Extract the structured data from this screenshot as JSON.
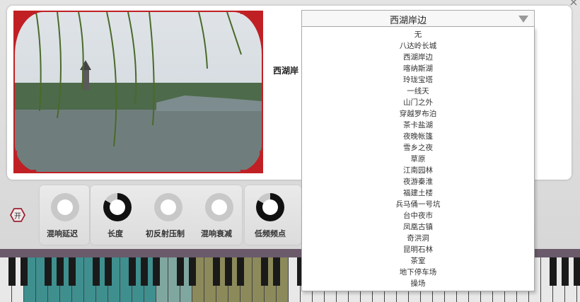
{
  "scene": {
    "selected": "西湖岸边",
    "label": "西湖岸",
    "options": [
      "无",
      "八达岭长城",
      "西湖岸边",
      "喀纳斯湖",
      "玲珑宝塔",
      "一线天",
      "山门之外",
      "穿越罗布泊",
      "茶卡盐湖",
      "夜晚帐篷",
      "雪乡之夜",
      "草原",
      "江南园林",
      "夜游秦淮",
      "福建土楼",
      "兵马俑一号坑",
      "台中夜市",
      "凤凰古镇",
      "奇洪洞",
      "昆明石林",
      "茶室",
      "地下停车场",
      "操场"
    ]
  },
  "power_label": "开",
  "knobs": [
    {
      "label": "混响延迟",
      "level": 0
    },
    {
      "label": "长度",
      "level": 0.83
    },
    {
      "label": "初反射压制",
      "level": 0
    },
    {
      "label": "混响衰减",
      "level": 0
    },
    {
      "label": "低频频点",
      "level": 0.83
    }
  ],
  "colors": {
    "frame_red": "#c02024",
    "teal_key": "#3f8f8f",
    "olive_key": "#8c8a5a"
  }
}
